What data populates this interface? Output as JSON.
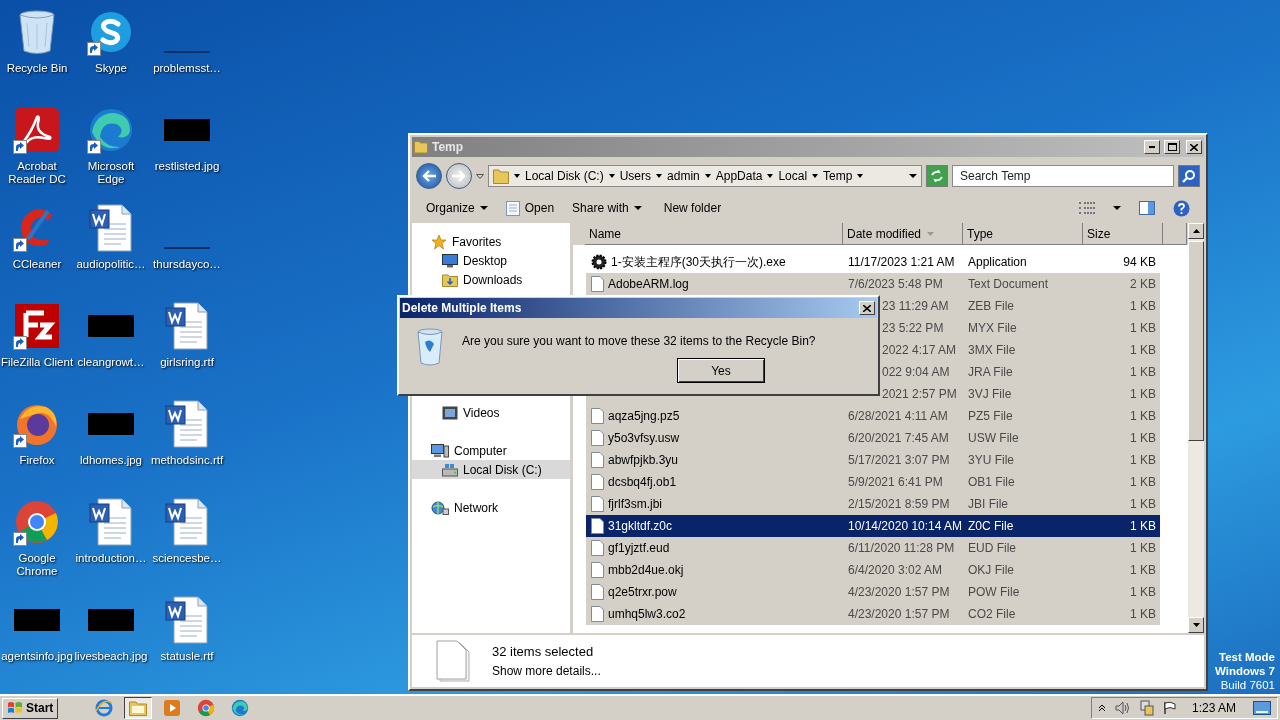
{
  "desktop_icons": [
    {
      "label": "Recycle Bin",
      "kind": "recycle",
      "shortcut": false
    },
    {
      "label": "Skype",
      "kind": "skype",
      "shortcut": true
    },
    {
      "label": "problemsst…",
      "kind": "blank",
      "shortcut": false
    },
    {
      "label": "Acrobat Reader DC",
      "kind": "acrobat",
      "shortcut": true
    },
    {
      "label": "Microsoft Edge",
      "kind": "edge",
      "shortcut": true
    },
    {
      "label": "restlisted.jpg",
      "kind": "thumb",
      "shortcut": false
    },
    {
      "label": "CCleaner",
      "kind": "ccleaner",
      "shortcut": true
    },
    {
      "label": "audiopolitic…",
      "kind": "word",
      "shortcut": false
    },
    {
      "label": "thursdayco…",
      "kind": "blank",
      "shortcut": false
    },
    {
      "label": "FileZilla Client",
      "kind": "filezilla",
      "shortcut": true
    },
    {
      "label": "cleangrowt…",
      "kind": "thumb",
      "shortcut": false
    },
    {
      "label": "girlsring.rtf",
      "kind": "word",
      "shortcut": false
    },
    {
      "label": "Firefox",
      "kind": "firefox",
      "shortcut": true
    },
    {
      "label": "ldhomes.jpg",
      "kind": "thumb",
      "shortcut": false
    },
    {
      "label": "methodsinc.rtf",
      "kind": "word",
      "shortcut": false
    },
    {
      "label": "Google Chrome",
      "kind": "chrome",
      "shortcut": true
    },
    {
      "label": "introduction…",
      "kind": "word",
      "shortcut": false
    },
    {
      "label": "sciencesbe…",
      "kind": "word",
      "shortcut": false
    },
    {
      "label": "agentsinfo.jpg",
      "kind": "thumb",
      "shortcut": false
    },
    {
      "label": "livesbeach.jpg",
      "kind": "thumb",
      "shortcut": false
    },
    {
      "label": "statusle.rtf",
      "kind": "word",
      "shortcut": false
    }
  ],
  "explorer": {
    "title": "Temp",
    "breadcrumb": [
      "Local Disk (C:)",
      "Users",
      "admin",
      "AppData",
      "Local",
      "Temp"
    ],
    "search": {
      "placeholder": "Search Temp"
    },
    "toolbar": [
      {
        "label": "Organize",
        "kind": "menu"
      },
      {
        "label": "Open",
        "kind": "open"
      },
      {
        "label": "Share with",
        "kind": "menu"
      },
      {
        "label": "New folder",
        "kind": "plain"
      }
    ],
    "navigation": [
      {
        "label": "Favorites",
        "kind": "favorites",
        "children": [
          {
            "label": "Desktop",
            "kind": "desktop",
            "selected": false
          },
          {
            "label": "Downloads",
            "kind": "downloads",
            "selected": false
          }
        ]
      },
      {
        "kind": "libraries",
        "children": [
          {
            "label": "Videos",
            "kind": "videos",
            "selected": false
          }
        ]
      },
      {
        "label": "Computer",
        "kind": "computer",
        "children": [
          {
            "label": "Local Disk (C:)",
            "kind": "disk",
            "selected": true
          }
        ]
      },
      {
        "label": "Network",
        "kind": "network"
      }
    ],
    "columns": [
      "Name",
      "Date modified",
      "Type",
      "Size"
    ],
    "rows": [
      {
        "name": "1-安装主程序(30天执行一次).exe",
        "kind": "exe",
        "date": "11/17/2023 1:21 AM",
        "type": "Application",
        "size": "94 KB",
        "selected": false,
        "focused": false,
        "covered": false
      },
      {
        "name": "AdobeARM.log",
        "kind": "file",
        "date": "7/6/2023 5:48 PM",
        "type": "Text Document",
        "size": "2 KB",
        "selected": true,
        "focused": false,
        "covered": false
      },
      {
        "kind": "hidden",
        "date": "23 11:29 AM",
        "type": "ZEB File",
        "size": "1 KB",
        "selected": true,
        "focused": false,
        "covered": true
      },
      {
        "kind": "hidden",
        "date": "23 5:22 PM",
        "type": "MYX File",
        "size": "1 KB",
        "selected": true,
        "focused": false,
        "covered": true
      },
      {
        "kind": "hidden",
        "date": "2022 4:17 AM",
        "type": "3MX File",
        "size": "1 KB",
        "selected": true,
        "focused": false,
        "covered": true
      },
      {
        "kind": "hidden",
        "date": "022 9:04 AM",
        "type": "JRA File",
        "size": "1 KB",
        "selected": true,
        "focused": false,
        "covered": true
      },
      {
        "kind": "hidden",
        "date": "2021 2:57 PM",
        "type": "3VJ File",
        "size": "1 KB",
        "selected": true,
        "focused": false,
        "covered": true
      },
      {
        "name": "aqza5jng.pz5",
        "kind": "file",
        "date": "6/28/2021 4:11 AM",
        "type": "PZ5 File",
        "size": "1 KB",
        "selected": true,
        "focused": false,
        "covered": false
      },
      {
        "name": "y5o3vfsy.usw",
        "kind": "file",
        "date": "6/20/2021 7:45 AM",
        "type": "USW File",
        "size": "1 KB",
        "selected": true,
        "focused": false,
        "covered": false
      },
      {
        "name": "abwfpjkb.3yu",
        "kind": "file",
        "date": "5/17/2021 3:07 PM",
        "type": "3YU File",
        "size": "1 KB",
        "selected": true,
        "focused": false,
        "covered": false
      },
      {
        "name": "dcsbq4fj.ob1",
        "kind": "file",
        "date": "5/9/2021 6:41 PM",
        "type": "OB1 File",
        "size": "1 KB",
        "selected": true,
        "focused": false,
        "covered": false
      },
      {
        "name": "fjrlf3sm.jbi",
        "kind": "file",
        "date": "2/15/2021 8:59 PM",
        "type": "JBI File",
        "size": "1 KB",
        "selected": true,
        "focused": false,
        "covered": false
      },
      {
        "name": "31gkltdf.z0c",
        "kind": "file",
        "date": "10/14/2020 10:14 AM",
        "type": "Z0C File",
        "size": "1 KB",
        "selected": true,
        "focused": true,
        "covered": false
      },
      {
        "name": "gf1yjztf.eud",
        "kind": "file",
        "date": "6/11/2020 11:28 PM",
        "type": "EUD File",
        "size": "1 KB",
        "selected": true,
        "focused": false,
        "covered": false
      },
      {
        "name": "mbb2d4ue.okj",
        "kind": "file",
        "date": "6/4/2020 3:02 AM",
        "type": "OKJ File",
        "size": "1 KB",
        "selected": true,
        "focused": false,
        "covered": false
      },
      {
        "name": "q2e5trxr.pow",
        "kind": "file",
        "date": "4/23/2020 1:57 PM",
        "type": "POW File",
        "size": "1 KB",
        "selected": true,
        "focused": false,
        "covered": false
      },
      {
        "name": "umhq5lw3.co2",
        "kind": "file",
        "date": "4/23/2020 1:57 PM",
        "type": "CO2 File",
        "size": "1 KB",
        "selected": true,
        "focused": false,
        "covered": false
      }
    ],
    "details": {
      "count": "32 items selected",
      "link": "Show more details..."
    }
  },
  "dialog": {
    "title": "Delete Multiple Items",
    "message": "Are you sure you want to move these 32 items to the Recycle Bin?",
    "buttons": [
      "Yes"
    ]
  },
  "system_notice": [
    "Test Mode",
    "Windows 7",
    "Build 7601"
  ],
  "taskbar": {
    "start": "Start",
    "apps": [
      {
        "kind": "ie",
        "active": false
      },
      {
        "kind": "explorer",
        "active": true
      },
      {
        "kind": "media",
        "active": false
      },
      {
        "kind": "chrome",
        "active": false
      },
      {
        "kind": "edge",
        "active": false
      }
    ],
    "clock": "1:23 AM"
  }
}
